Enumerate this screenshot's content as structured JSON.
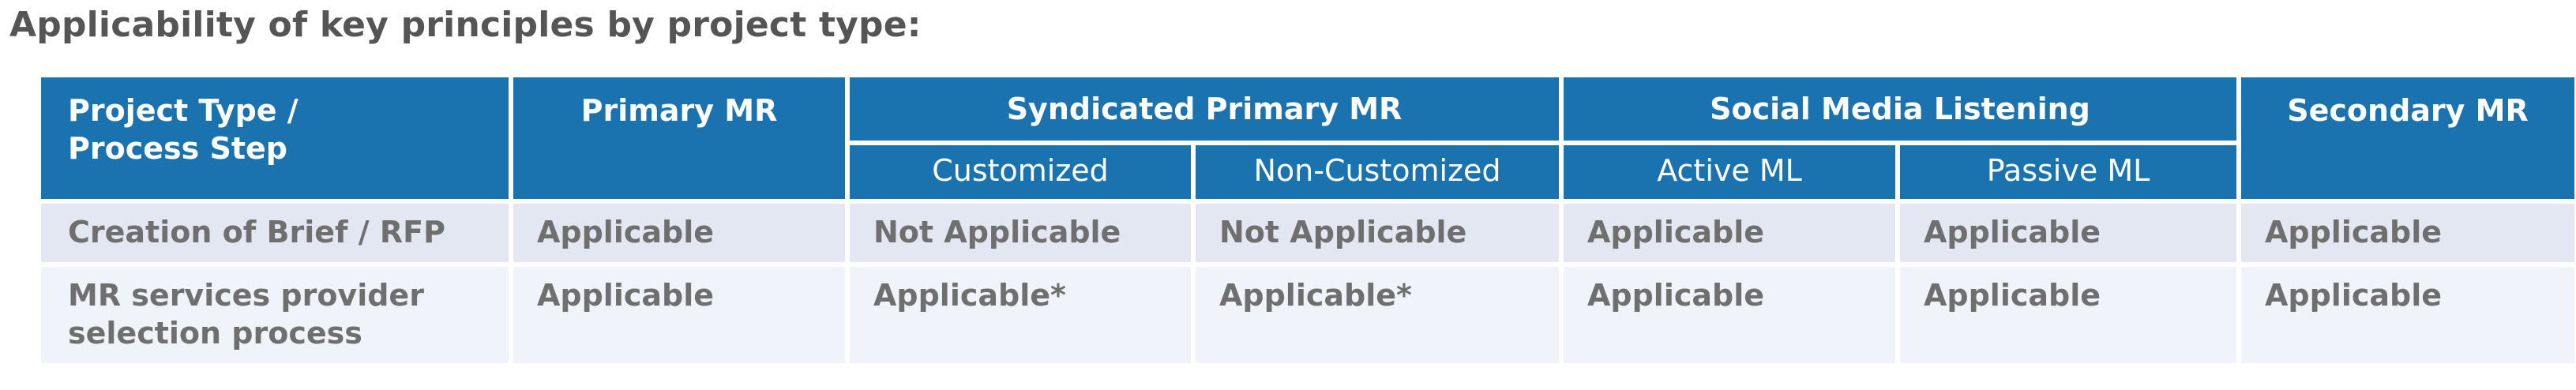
{
  "title": "Applicability of key principles by project type:",
  "header": {
    "process_step_line1": "Project Type /",
    "process_step_line2": "Process Step",
    "primary_mr": "Primary MR",
    "syndicated_primary_mr": "Syndicated Primary MR",
    "social_media_listening": "Social Media Listening",
    "secondary_mr": "Secondary MR",
    "sub": {
      "customized": "Customized",
      "non_customized": "Non-Customized",
      "active_ml": "Active ML",
      "passive_ml": "Passive ML"
    }
  },
  "rows": [
    {
      "label_line1": "Creation of Brief / RFP",
      "label_line2": "",
      "values": [
        "Applicable",
        "Not Applicable",
        "Not Applicable",
        "Applicable",
        "Applicable",
        "Applicable"
      ]
    },
    {
      "label_line1": "MR services provider",
      "label_line2": "selection process",
      "values": [
        "Applicable",
        "Applicable*",
        "Applicable*",
        "Applicable",
        "Applicable",
        "Applicable"
      ]
    }
  ],
  "colors": {
    "header_bg": "#1a72ae",
    "header_text": "#ffffff",
    "row1_bg": "#e3e7f2",
    "row2_bg": "#f0f3f9",
    "body_text": "#6f6f6f",
    "title_text": "#555555"
  }
}
